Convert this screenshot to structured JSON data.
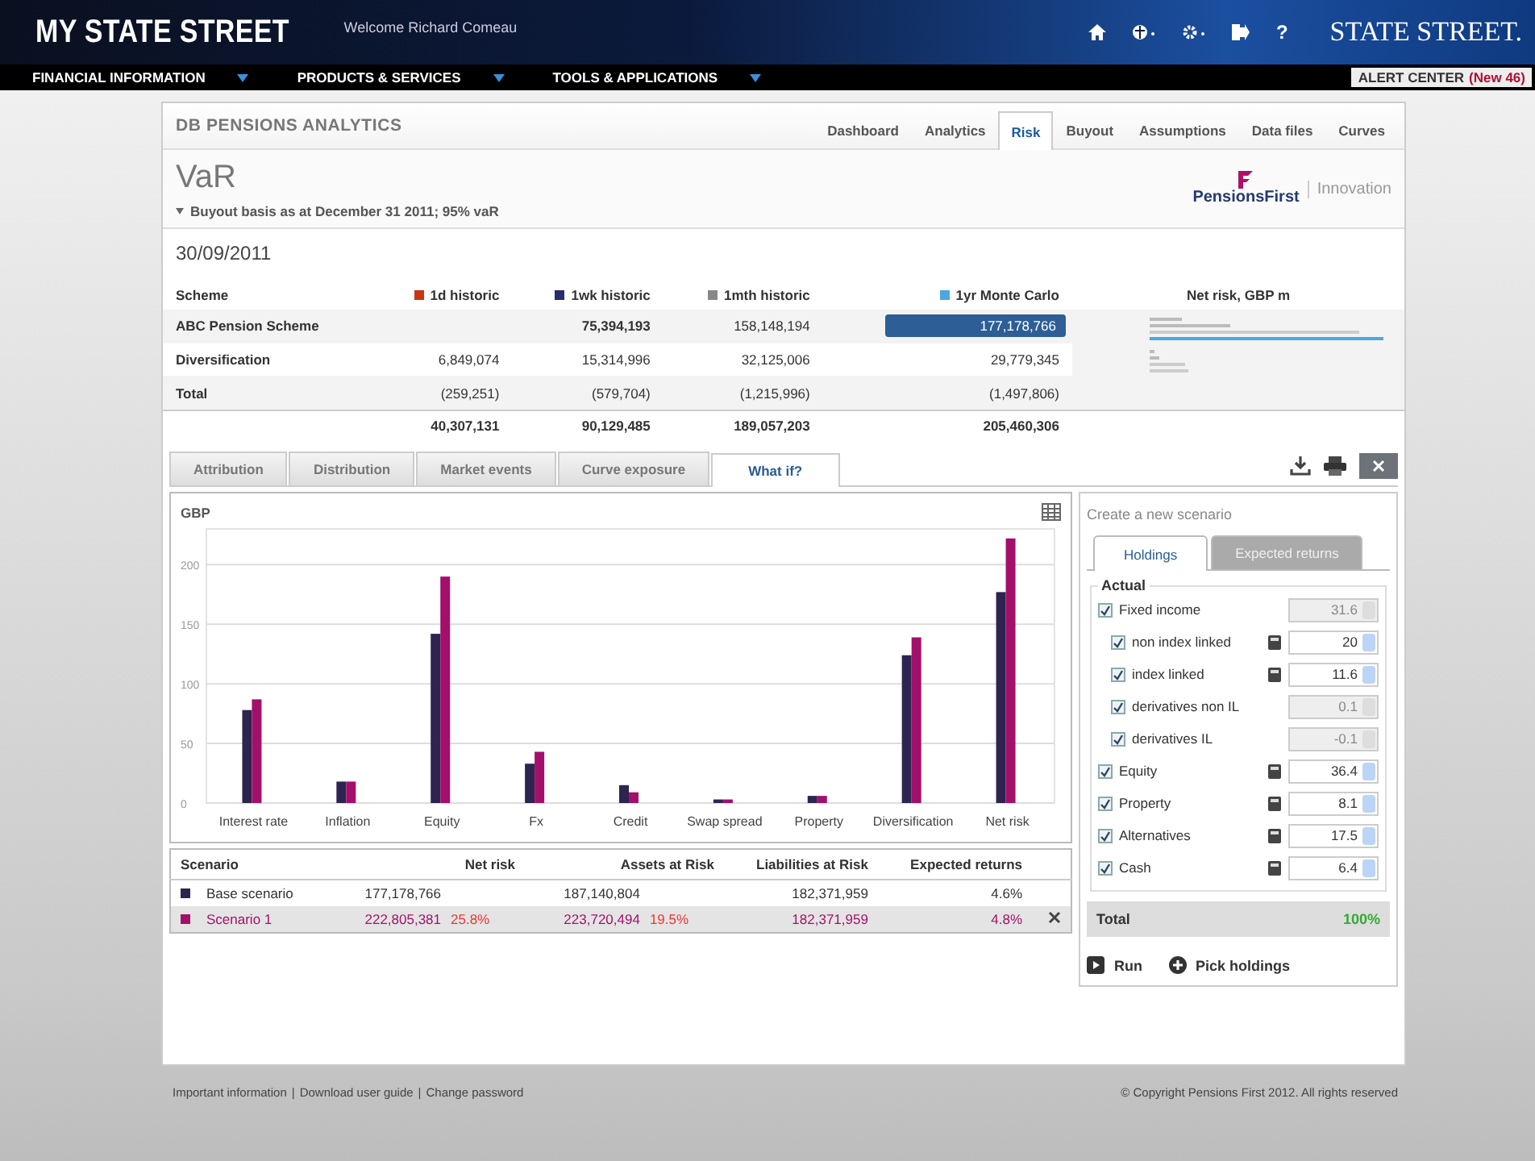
{
  "header": {
    "logo": "MY STATE STREET",
    "welcome": "Welcome Richard Comeau",
    "help": "?",
    "brand": "STATE STREET."
  },
  "nav": {
    "menus": [
      {
        "label": "FINANCIAL INFORMATION"
      },
      {
        "label": "PRODUCTS & SERVICES"
      },
      {
        "label": "TOOLS & APPLICATIONS"
      }
    ],
    "alert": "ALERT CENTER",
    "alert_count": "(New 46)"
  },
  "app": {
    "title": "DB PENSIONS ANALYTICS",
    "tabs": [
      {
        "label": "Dashboard",
        "selected": false
      },
      {
        "label": "Analytics",
        "selected": false
      },
      {
        "label": "Risk",
        "selected": true
      },
      {
        "label": "Buyout",
        "selected": false
      },
      {
        "label": "Assumptions",
        "selected": false
      },
      {
        "label": "Data files",
        "selected": false
      },
      {
        "label": "Curves",
        "selected": false
      }
    ],
    "page_title": "VaR",
    "basis": "Buyout basis as at December 31 2011; 95% vaR",
    "partner_logo": "PensionsFirst",
    "partner_tagline": "Innovation",
    "date": "30/09/2011"
  },
  "summary": {
    "columns": [
      {
        "label": "Scheme"
      },
      {
        "label": "1d historic",
        "color": "#cc3311"
      },
      {
        "label": "1wk historic",
        "color": "#2a2a6e"
      },
      {
        "label": "1mth historic",
        "color": "#888888"
      },
      {
        "label": "1yr Monte Carlo",
        "color": "#4aa8e0"
      },
      {
        "label": "Net risk, GBP m"
      }
    ],
    "rows": [
      {
        "kind": "row",
        "selected": true,
        "scheme": "ABC Pension Scheme",
        "wk1": "75,394,193",
        "mth1": "158,148,194",
        "mc1y": "177,178,766"
      },
      {
        "kind": "row",
        "selected": false,
        "scheme": "Diversification",
        "d1": "6,849,074",
        "wk1": "15,314,996",
        "mth1": "32,125,006",
        "mc1y": "29,779,345"
      },
      {
        "kind": "row",
        "selected": false,
        "scheme": "Total",
        "d1": "(259,251)",
        "wk1": "(579,704)",
        "mth1": "(1,215,996)",
        "mc1y": "(1,497,806)"
      },
      {
        "kind": "sum",
        "selected": false,
        "d1": "40,307,131",
        "wk1": "90,129,485",
        "mth1": "189,057,203",
        "mc1y": "205,460,306"
      }
    ]
  },
  "subtabs": [
    {
      "label": "Attribution",
      "selected": false
    },
    {
      "label": "Distribution",
      "selected": false
    },
    {
      "label": "Market events",
      "selected": false
    },
    {
      "label": "Curve exposure",
      "selected": false
    },
    {
      "label": "What if?",
      "selected": true
    }
  ],
  "chart": {
    "chart_data": {
      "type": "bar",
      "ylabel": "GBP",
      "categories": [
        "Interest rate",
        "Inflation",
        "Equity",
        "Fx",
        "Credit",
        "Swap spread",
        "Property",
        "Diversification",
        "Net risk"
      ],
      "series": [
        {
          "color": "#2e2450",
          "values": [
            78,
            18,
            142,
            33,
            15,
            3,
            6,
            124,
            177
          ]
        },
        {
          "color": "#a3106c",
          "values": [
            87,
            18,
            190,
            43,
            9,
            3,
            6,
            139,
            222
          ]
        }
      ],
      "grid": true,
      "ylim": [
        0,
        230
      ],
      "yticks": [
        0,
        50,
        100,
        150,
        200
      ]
    }
  },
  "scenarios": {
    "columns": [
      "Scenario",
      "Net risk",
      "Assets at Risk",
      "Liabilities at Risk",
      "Expected returns"
    ],
    "rows": [
      {
        "name": "Base scenario",
        "color": "#2e2450",
        "selected": false,
        "net_risk": "177,178,766",
        "assets": "187,140,804",
        "liabilities": "182,371,959",
        "returns": "4.6%",
        "removable": false
      },
      {
        "name": "Scenario 1",
        "color": "#a3106c",
        "selected": true,
        "net_risk": "222,805,381",
        "net_risk_change": "25.8%",
        "assets": "223,720,494",
        "assets_change": "19.5%",
        "liabilities": "182,371,959",
        "returns": "4.8%",
        "removable": true
      }
    ]
  },
  "scenario_panel": {
    "title": "Create a new scenario",
    "tabs": [
      {
        "label": "Holdings",
        "selected": true
      },
      {
        "label": "Expected returns",
        "selected": false
      }
    ],
    "group": "Actual",
    "holdings": [
      {
        "label": "Fixed income",
        "checked": true,
        "editable": false,
        "value": "31.6",
        "children": [
          {
            "label": "non index linked",
            "checked": true,
            "editable": true,
            "value": "20"
          },
          {
            "label": "index linked",
            "checked": true,
            "editable": true,
            "value": "11.6"
          },
          {
            "label": "derivatives non IL",
            "checked": true,
            "editable": false,
            "value": "0.1"
          },
          {
            "label": "derivatives IL",
            "checked": true,
            "editable": false,
            "value": "-0.1"
          }
        ]
      },
      {
        "label": "Equity",
        "checked": true,
        "editable": true,
        "value": "36.4"
      },
      {
        "label": "Property",
        "checked": true,
        "editable": true,
        "value": "8.1"
      },
      {
        "label": "Alternatives",
        "checked": true,
        "editable": true,
        "value": "17.5"
      },
      {
        "label": "Cash",
        "checked": true,
        "editable": true,
        "value": "6.4"
      }
    ],
    "total_label": "Total",
    "total_value": "100%",
    "run": "Run",
    "pick": "Pick holdings"
  },
  "footer": {
    "separator": "|",
    "links": [
      "Important information",
      "Download user guide",
      "Change password"
    ],
    "copyright": "© Copyright Pensions First 2012. All rights reserved"
  }
}
